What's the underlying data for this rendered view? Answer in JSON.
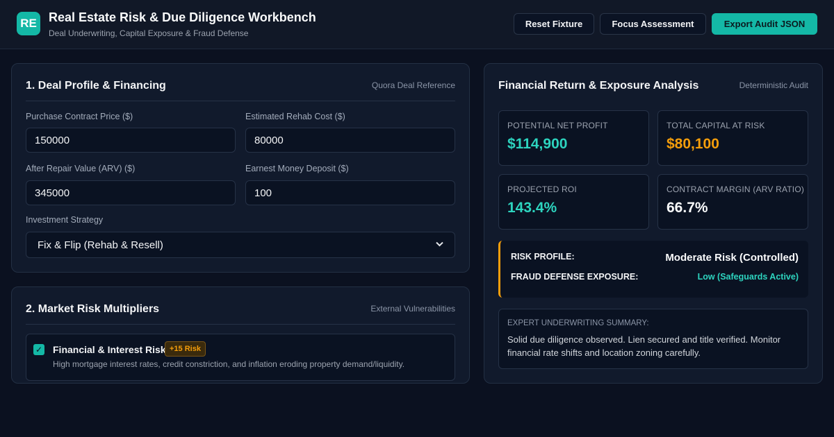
{
  "header": {
    "logo_text": "RE",
    "title": "Real Estate Risk & Due Diligence Workbench",
    "subtitle": "Deal Underwriting, Capital Exposure & Fraud Defense",
    "buttons": {
      "reset": "Reset Fixture",
      "focus": "Focus Assessment",
      "export": "Export Audit JSON"
    }
  },
  "deal_profile": {
    "title": "1. Deal Profile & Financing",
    "tag": "Quora Deal Reference",
    "fields": {
      "purchase_price": {
        "label": "Purchase Contract Price ($)",
        "value": "150000"
      },
      "rehab_cost": {
        "label": "Estimated Rehab Cost ($)",
        "value": "80000"
      },
      "arv": {
        "label": "After Repair Value (ARV) ($)",
        "value": "345000"
      },
      "earnest_money": {
        "label": "Earnest Money Deposit ($)",
        "value": "100"
      }
    },
    "strategy": {
      "label": "Investment Strategy",
      "value": "Fix & Flip (Rehab & Resell)"
    }
  },
  "market_risk": {
    "title": "2. Market Risk Multipliers",
    "tag": "External Vulnerabilities",
    "items": [
      {
        "name": "Financial & Interest Risk",
        "badge": "+15 Risk",
        "description": "High mortgage interest rates, credit constriction, and inflation eroding property demand/liquidity.",
        "checked": true,
        "check_glyph": "✓"
      }
    ]
  },
  "analysis": {
    "title": "Financial Return & Exposure Analysis",
    "tag": "Deterministic Audit",
    "metrics": {
      "net_profit": {
        "label": "POTENTIAL NET PROFIT",
        "value": "$114,900",
        "color": "#2dd4bf"
      },
      "capital_at_risk": {
        "label": "TOTAL CAPITAL AT RISK",
        "value": "$80,100",
        "color": "#f59e0b"
      },
      "roi": {
        "label": "PROJECTED ROI",
        "value": "143.4%",
        "color": "#2dd4bf"
      },
      "margin": {
        "label": "CONTRACT MARGIN (ARV RATIO)",
        "value": "66.7%",
        "color": "#f9fafb"
      }
    },
    "risk_profile": {
      "label": "RISK PROFILE:",
      "value": "Moderate Risk (Controlled)"
    },
    "fraud_exposure": {
      "label": "FRAUD DEFENSE EXPOSURE:",
      "value": "Low (Safeguards Active)",
      "color": "#2dd4bf"
    },
    "summary": {
      "label": "EXPERT UNDERWRITING SUMMARY:",
      "text": "Solid due diligence observed. Lien secured and title verified. Monitor financial rate shifts and location zoning carefully."
    }
  },
  "colors": {
    "accent": "#14b8a6",
    "warning": "#f59e0b",
    "background": "#0b1120",
    "card": "#111a2c"
  }
}
